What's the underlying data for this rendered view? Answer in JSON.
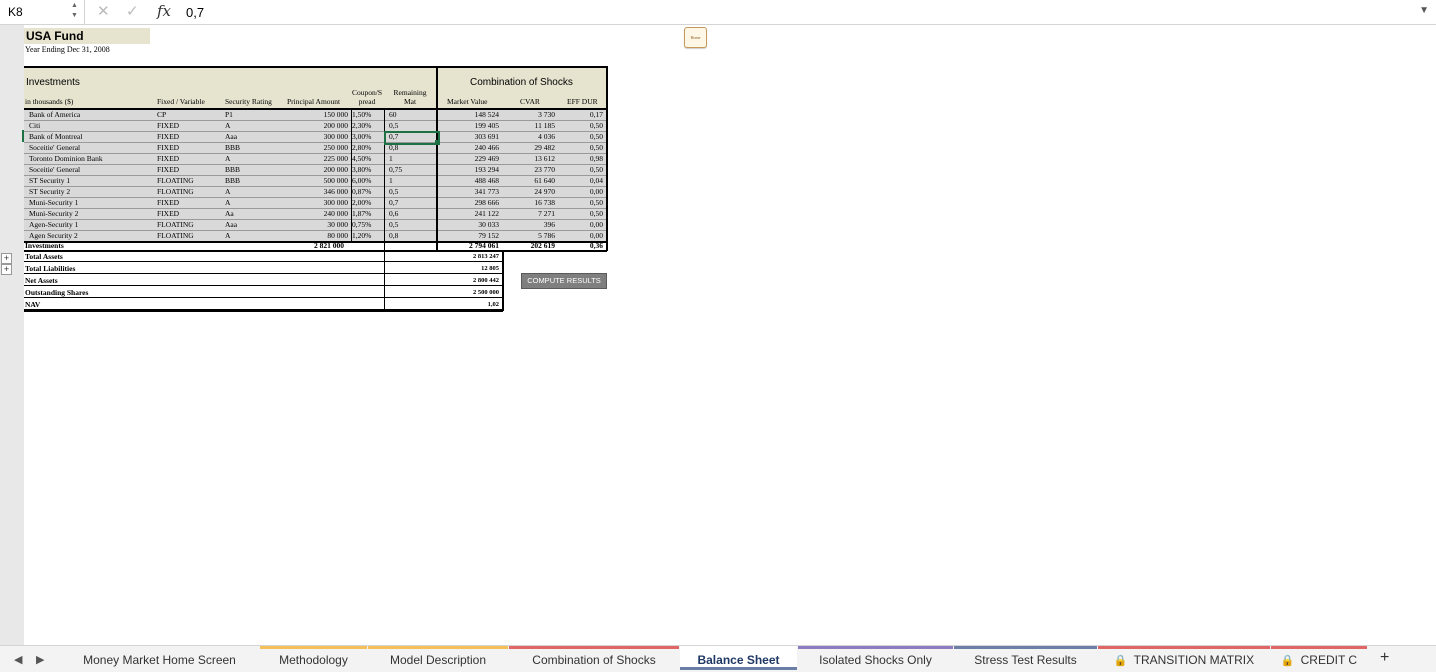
{
  "formula_bar": {
    "name_box": "K8",
    "fx_label": "fx",
    "value": "0,7",
    "cancel": "✕",
    "enter": "✓"
  },
  "sheet": {
    "title": "USA Fund",
    "subtitle": "Year Ending Dec 31, 2008",
    "note_button_label": "Home",
    "section_investments": "Investments",
    "section_shocks": "Combination of Shocks",
    "col_headers": {
      "name": "in thousands ($)",
      "fixed_variable": "Fixed / Variable",
      "rating": "Security Rating",
      "principal": "Principal Amount",
      "coupon_top": "Coupon/S",
      "coupon_bottom": "pread",
      "mat_top": "Remaining",
      "mat_bottom": "Mat",
      "market_value": "Market Value",
      "cvar": "CVAR",
      "eff_dur": "EFF DUR"
    },
    "rows": [
      {
        "name": "Bank of America",
        "type": "CP",
        "rating": "P1",
        "principal": "150 000",
        "coupon": "1,50%",
        "mat": "60",
        "mv": "148 524",
        "cvar": "3 730",
        "dur": "0,17"
      },
      {
        "name": "Citi",
        "type": "FIXED",
        "rating": "A",
        "principal": "200 000",
        "coupon": "2,30%",
        "mat": "0,5",
        "mv": "199 405",
        "cvar": "11 185",
        "dur": "0,50"
      },
      {
        "name": "Bank of Montreal",
        "type": "FIXED",
        "rating": "Aaa",
        "principal": "300 000",
        "coupon": "3,00%",
        "mat": "0,7",
        "mv": "303 691",
        "cvar": "4 036",
        "dur": "0,50"
      },
      {
        "name": "Soceitie' General",
        "type": "FIXED",
        "rating": "BBB",
        "principal": "250 000",
        "coupon": "2,80%",
        "mat": "0,8",
        "mv": "240 466",
        "cvar": "29 482",
        "dur": "0,50"
      },
      {
        "name": "Toronto Dominion Bank",
        "type": "FIXED",
        "rating": "A",
        "principal": "225 000",
        "coupon": "4,50%",
        "mat": "1",
        "mv": "229 469",
        "cvar": "13 612",
        "dur": "0,98"
      },
      {
        "name": "Soceitie' General",
        "type": "FIXED",
        "rating": "BBB",
        "principal": "200 000",
        "coupon": "3,80%",
        "mat": "0,75",
        "mv": "193 294",
        "cvar": "23 770",
        "dur": "0,50"
      },
      {
        "name": "ST Security 1",
        "type": "FLOATING",
        "rating": "BBB",
        "principal": "500 000",
        "coupon": "6,00%",
        "mat": "1",
        "mv": "488 468",
        "cvar": "61 640",
        "dur": "0,04"
      },
      {
        "name": "ST Security 2",
        "type": "FLOATING",
        "rating": "A",
        "principal": "346 000",
        "coupon": "0,87%",
        "mat": "0,5",
        "mv": "341 773",
        "cvar": "24 970",
        "dur": "0,00"
      },
      {
        "name": "Muni-Security 1",
        "type": "FIXED",
        "rating": "A",
        "principal": "300 000",
        "coupon": "2,00%",
        "mat": "0,7",
        "mv": "298 666",
        "cvar": "16 738",
        "dur": "0,50"
      },
      {
        "name": "Muni-Security 2",
        "type": "FIXED",
        "rating": "Aa",
        "principal": "240 000",
        "coupon": "1,87%",
        "mat": "0,6",
        "mv": "241 122",
        "cvar": "7 271",
        "dur": "0,50"
      },
      {
        "name": "Agen-Security 1",
        "type": "FLOATING",
        "rating": "Aaa",
        "principal": "30 000",
        "coupon": "0,75%",
        "mat": "0,5",
        "mv": "30 033",
        "cvar": "396",
        "dur": "0,00"
      },
      {
        "name": "Agen Security 2",
        "type": "FLOATING",
        "rating": "A",
        "principal": "80 000",
        "coupon": "1,20%",
        "mat": "0,8",
        "mv": "79 152",
        "cvar": "5 786",
        "dur": "0,00"
      }
    ],
    "totals": {
      "label": "Investments",
      "principal": "2 821 000",
      "mv": "2 794 061",
      "cvar": "202 619",
      "dur": "0,36"
    },
    "summary": [
      {
        "label": "Total Assets",
        "value": "2 813 247"
      },
      {
        "label": "Total Liabilities",
        "value": "12 805"
      },
      {
        "label": "Net Assets",
        "value": "2 800 442"
      },
      {
        "label": "Outstanding Shares",
        "value": "2 500 000"
      },
      {
        "label": "NAV",
        "value": "1,02"
      }
    ],
    "compute_button": "COMPUTE RESULTS"
  },
  "tabs": [
    {
      "label": "Money Market Home Screen",
      "color": "#f3f3f3"
    },
    {
      "label": "Methodology",
      "color": "#f4c05a"
    },
    {
      "label": "Model Description",
      "color": "#f4c05a"
    },
    {
      "label": "Combination of Shocks",
      "color": "#e06666"
    },
    {
      "label": "Balance Sheet",
      "color": "#ffffff"
    },
    {
      "label": "Isolated Shocks Only",
      "color": "#8e7cc3"
    },
    {
      "label": "Stress Test Results",
      "color": "#6d7fa6"
    },
    {
      "label": "TRANSITION MATRIX",
      "color": "#e06666"
    },
    {
      "label": "CREDIT C",
      "color": "#e06666"
    }
  ],
  "add_sheet": "+"
}
